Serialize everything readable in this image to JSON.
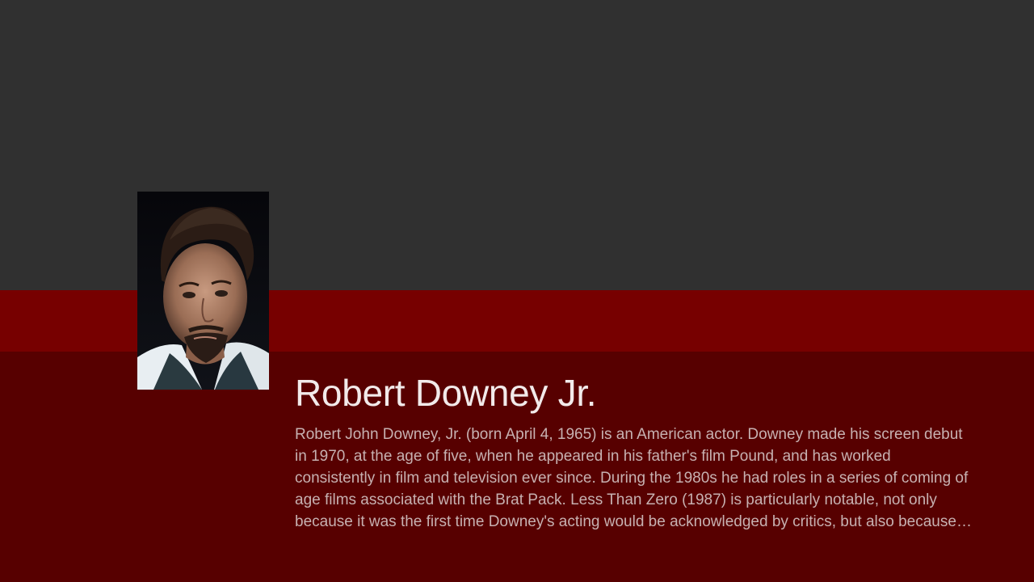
{
  "person": {
    "name": "Robert Downey Jr.",
    "biography": "Robert John Downey, Jr. (born April 4, 1965) is an American actor. Downey made his screen debut in 1970, at the age of five, when he appeared in his father's film Pound, and has worked consistently in film and television ever since. During the 1980s he had roles in a series of coming of age films associated with the Brat Pack. Less Than Zero (1987) is particularly notable, not only because it was the first time Downey's acting would be acknowledged by critics, but also because the role pushed Downey's addiction to drugs one step further.",
    "portrait_icon": "person-portrait-image"
  },
  "colors": {
    "backdrop": "#303030",
    "band": "#770000",
    "panel": "#570000",
    "title_text": "#f2eaea",
    "bio_text": "#c7b1b1"
  }
}
